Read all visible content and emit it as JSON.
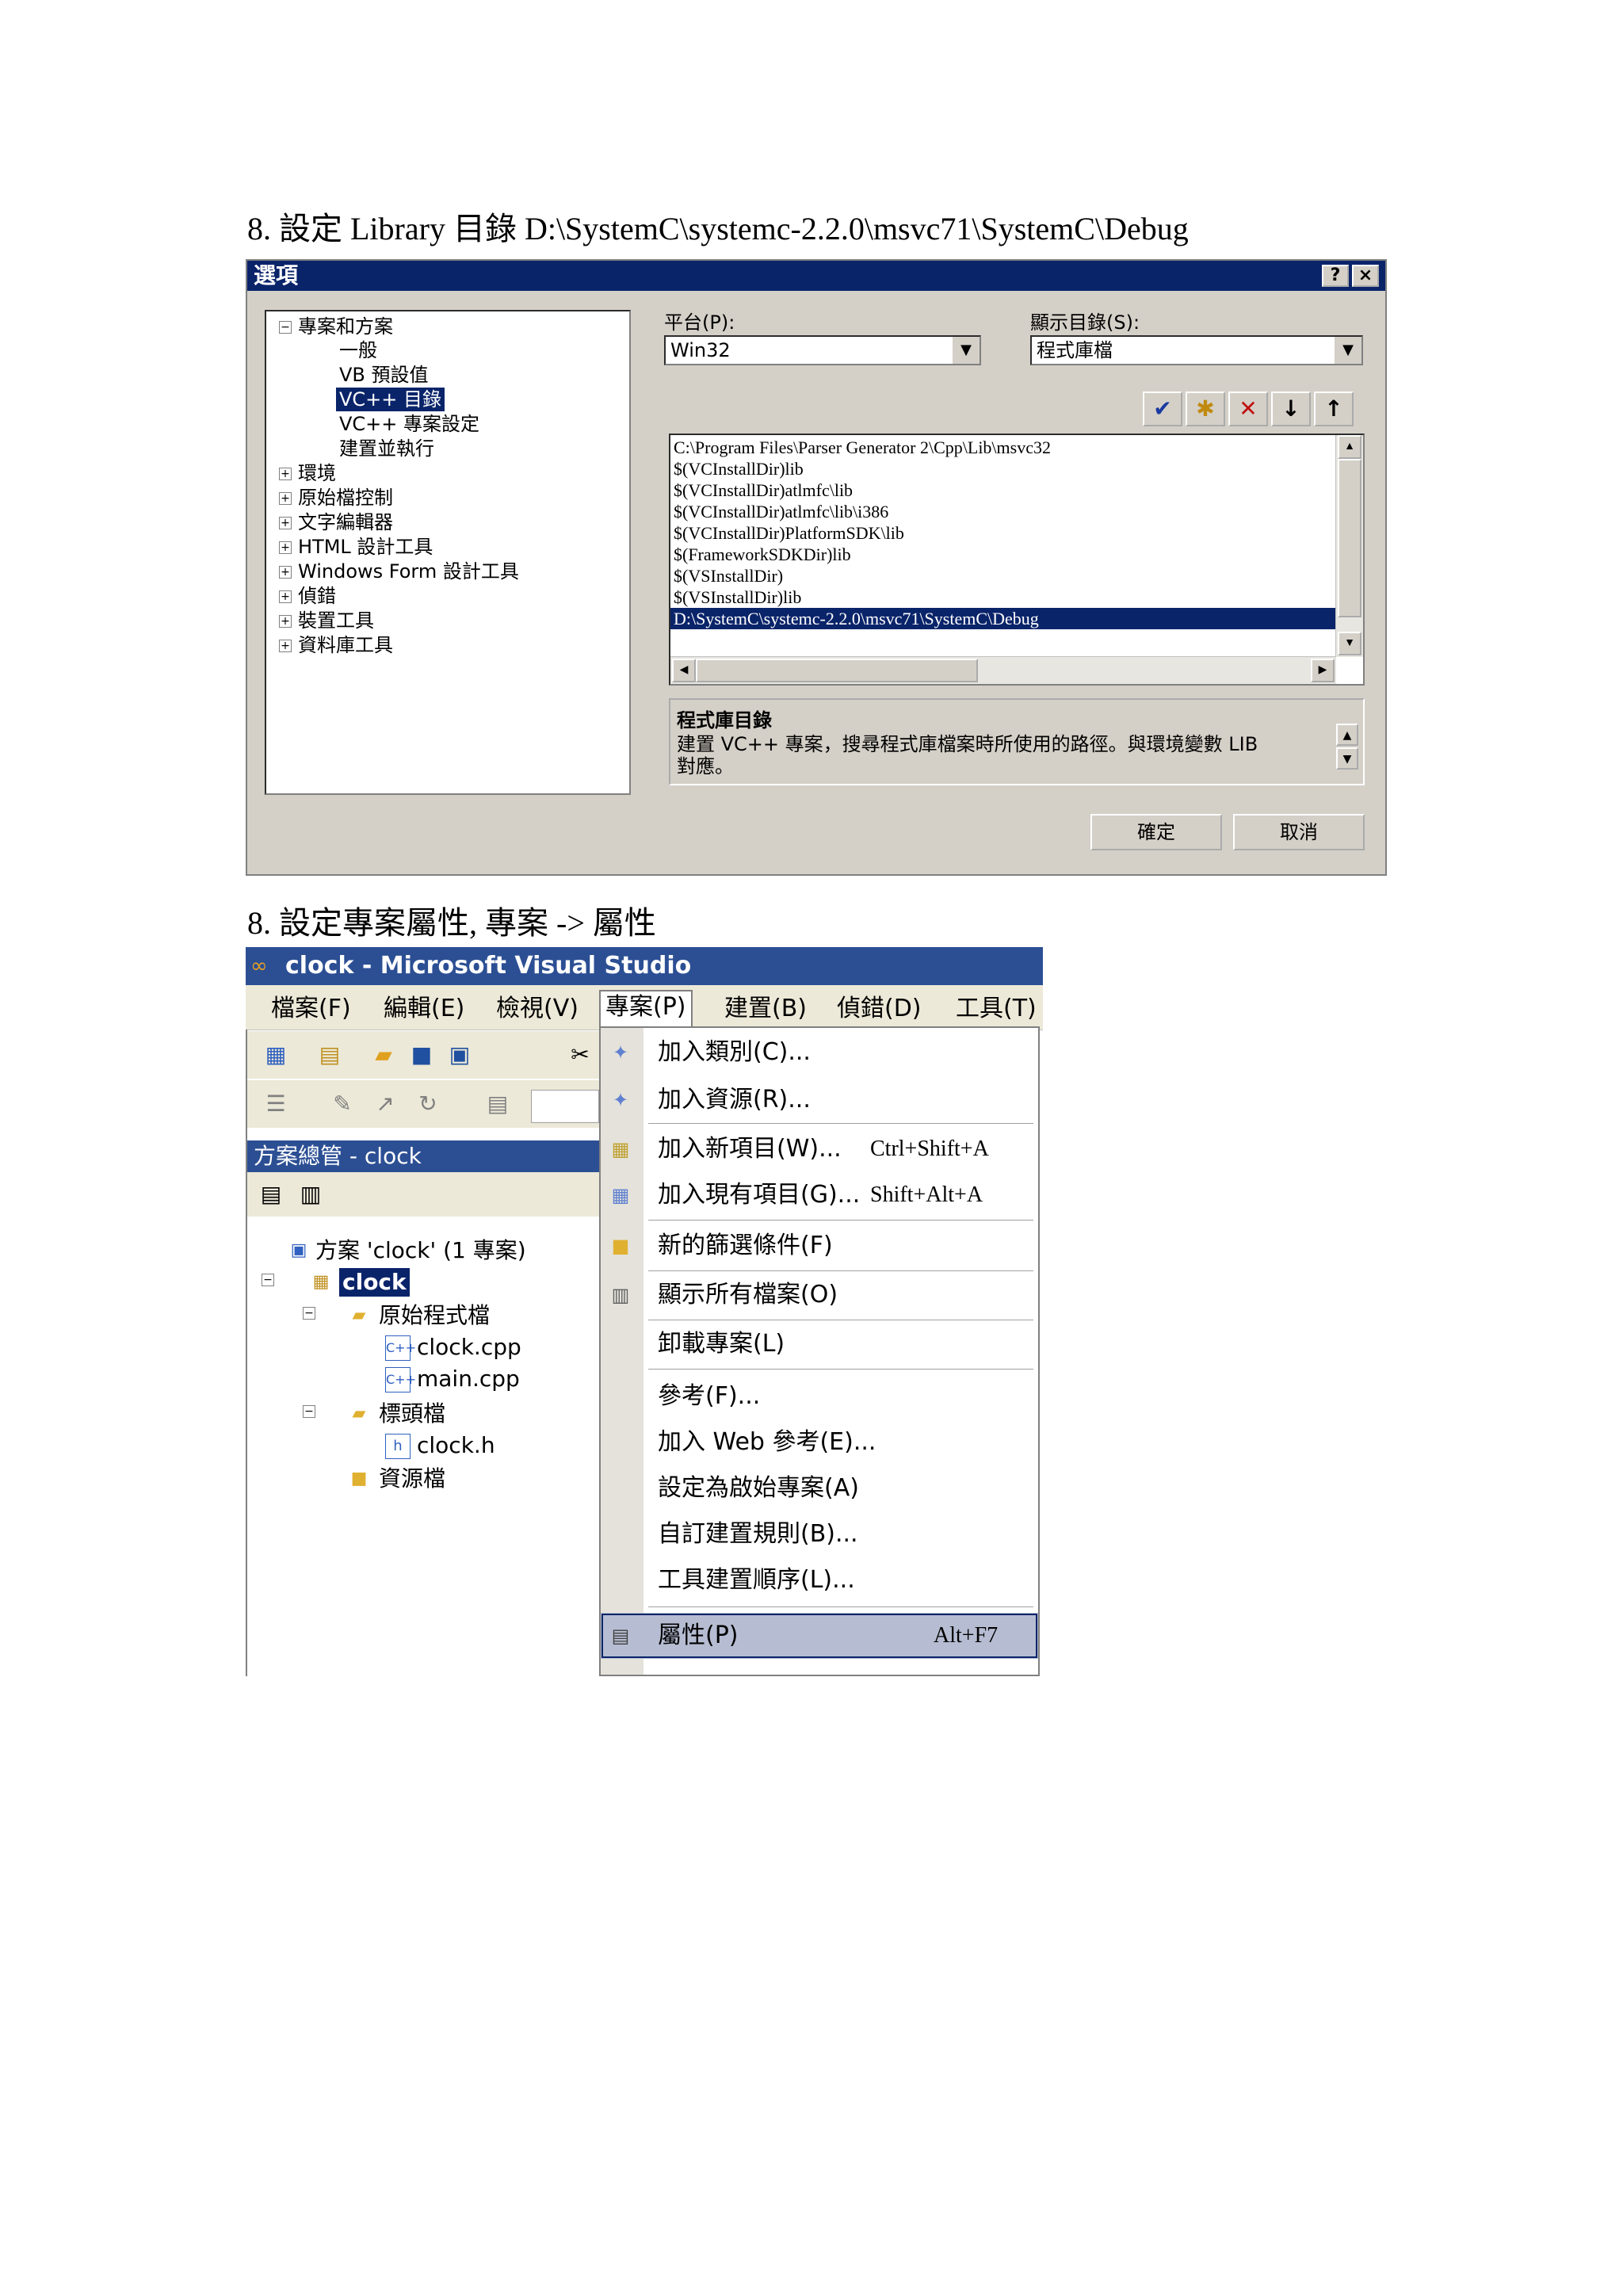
{
  "caption1": "8.  設定 Library 目錄  D:\\SystemC\\systemc-2.2.0\\msvc71\\SystemC\\Debug",
  "caption2": "8.      設定專案屬性, 專案  ->  屬性",
  "options_dialog": {
    "title": "選項",
    "help_btn": "?",
    "close_btn": "×",
    "tree": {
      "root": "專案和方案",
      "children": [
        "一般",
        "VB 預設值",
        "VC++ 目錄",
        "VC++ 專案設定",
        "建置並執行"
      ],
      "others": [
        "環境",
        "原始檔控制",
        "文字編輯器",
        "HTML 設計工具",
        "Windows Form 設計工具",
        "偵錯",
        "裝置工具",
        "資料庫工具"
      ],
      "selected": "VC++ 目錄"
    },
    "platform_label": "平台(P):",
    "platform_value": "Win32",
    "show_dirs_label": "顯示目錄(S):",
    "show_dirs_value": "程式庫檔",
    "toolbar_icons": [
      "checkmark-icon",
      "new-folder-icon",
      "delete-icon",
      "move-down-icon",
      "move-up-icon"
    ],
    "toolbar_glyphs": [
      "✔",
      "✱",
      "✕",
      "↓",
      "↑"
    ],
    "dirs": [
      "C:\\Program Files\\Parser Generator 2\\Cpp\\Lib\\msvc32",
      "$(VCInstallDir)lib",
      "$(VCInstallDir)atlmfc\\lib",
      "$(VCInstallDir)atlmfc\\lib\\i386",
      "$(VCInstallDir)PlatformSDK\\lib",
      "$(FrameworkSDKDir)lib",
      "$(VSInstallDir)",
      "$(VSInstallDir)lib",
      "D:\\SystemC\\systemc-2.2.0\\msvc71\\SystemC\\Debug"
    ],
    "selected_dir_index": 8,
    "desc_title": "程式庫目錄",
    "desc_line1": "建置 VC++ 專案，搜尋程式庫檔案時所使用的路徑。與環境變數 LIB",
    "desc_line2": "對應。",
    "ok": "確定",
    "cancel": "取消"
  },
  "vs_window": {
    "title": "clock - Microsoft Visual Studio",
    "menus": [
      "檔案(F)",
      "編輯(E)",
      "檢視(V)",
      "專案(P)",
      "建置(B)",
      "偵錯(D)",
      "工具(T)"
    ],
    "open_menu_index": 3,
    "solution_explorer_title": "方案總管 - clock",
    "tree": {
      "solution": "方案 'clock' (1 專案)",
      "project": "clock",
      "source_folder": "原始程式檔",
      "source_files": [
        "clock.cpp",
        "main.cpp"
      ],
      "header_folder": "標頭檔",
      "header_files": [
        "clock.h"
      ],
      "resource_folder": "資源檔"
    },
    "project_menu": [
      {
        "label": "加入類別(C)...",
        "shortcut": ""
      },
      {
        "label": "加入資源(R)...",
        "shortcut": ""
      },
      {
        "label": "加入新項目(W)...",
        "shortcut": "Ctrl+Shift+A"
      },
      {
        "label": "加入現有項目(G)...",
        "shortcut": "Shift+Alt+A"
      },
      {
        "label": "新的篩選條件(F)",
        "shortcut": ""
      },
      {
        "label": "顯示所有檔案(O)",
        "shortcut": ""
      },
      {
        "label": "卸載專案(L)",
        "shortcut": ""
      },
      {
        "label": "參考(F)...",
        "shortcut": ""
      },
      {
        "label": "加入 Web 參考(E)...",
        "shortcut": ""
      },
      {
        "label": "設定為啟始專案(A)",
        "shortcut": ""
      },
      {
        "label": "自訂建置規則(B)...",
        "shortcut": ""
      },
      {
        "label": "工具建置順序(L)...",
        "shortcut": ""
      },
      {
        "label": "屬性(P)",
        "shortcut": "Alt+F7"
      }
    ],
    "highlighted_item_index": 12
  }
}
